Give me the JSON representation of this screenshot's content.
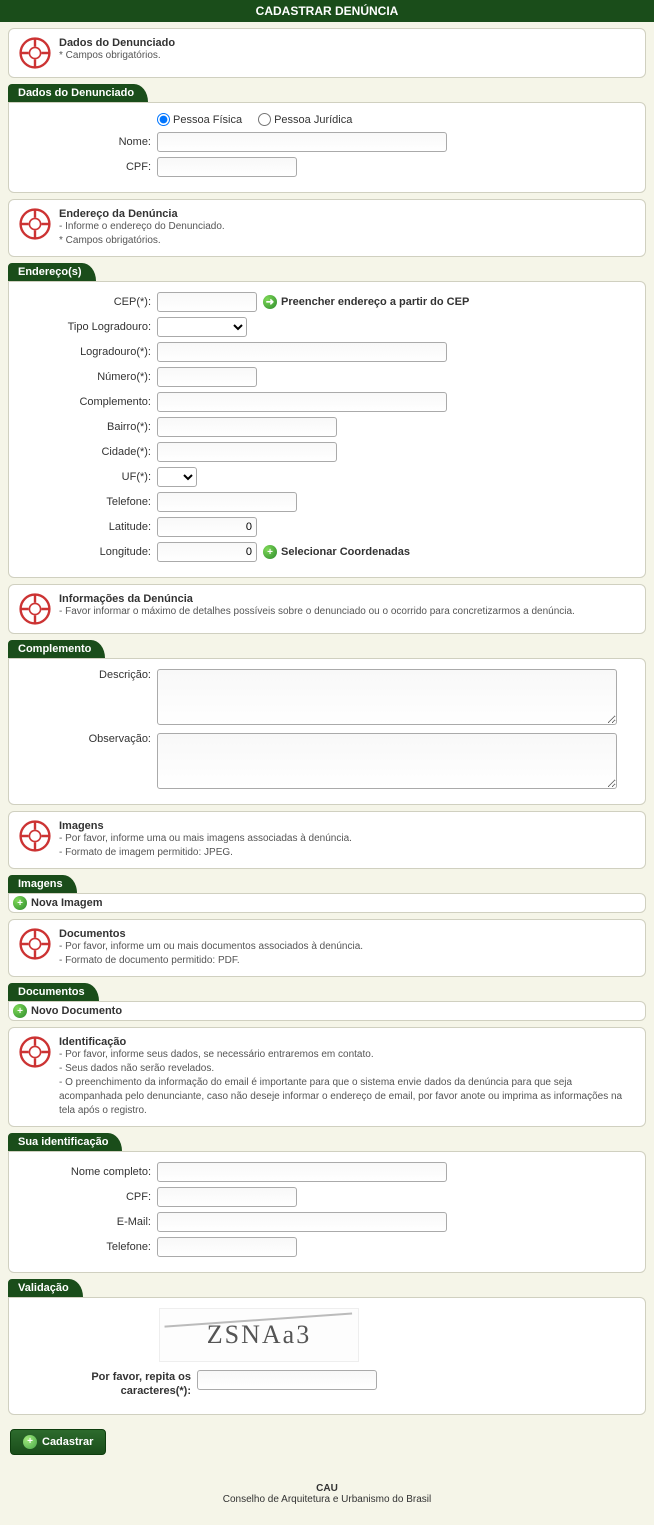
{
  "title": "CADASTRAR DENÚNCIA",
  "panels": {
    "dados_header": {
      "title": "Dados do Denunciado",
      "sub": "* Campos obrigatórios."
    },
    "endereco_header": {
      "title": "Endereço da Denúncia",
      "sub1": "- Informe o endereço do Denunciado.",
      "sub2": "* Campos obrigatórios."
    },
    "info_header": {
      "title": "Informações da Denúncia",
      "sub": "- Favor informar o máximo de detalhes possíveis sobre o denunciado ou o ocorrido para concretizarmos a denúncia."
    },
    "imagens_header": {
      "title": "Imagens",
      "sub1": "- Por favor, informe uma ou mais imagens associadas à denúncia.",
      "sub2": "- Formato de imagem permitido: JPEG."
    },
    "documentos_header": {
      "title": "Documentos",
      "sub1": "- Por favor, informe um ou mais documentos associados à denúncia.",
      "sub2": "- Formato de documento permitido: PDF."
    },
    "identificacao_header": {
      "title": "Identificação",
      "sub1": "- Por favor, informe seus dados, se necessário entraremos em contato.",
      "sub2": "- Seus dados não serão revelados.",
      "sub3": "- O preenchimento da informação do email é importante para que o sistema envie dados da denúncia para que seja acompanhada pelo denunciante, caso não deseje informar o endereço de email, por favor anote ou imprima as informações na tela após o registro."
    }
  },
  "sections": {
    "dados": {
      "tab": "Dados do Denunciado",
      "radio_pf": "Pessoa Física",
      "radio_pj": "Pessoa Jurídica",
      "nome": "Nome:",
      "cpf": "CPF:"
    },
    "endereco": {
      "tab": "Endereço(s)",
      "cep": "CEP(*):",
      "cep_link": "Preencher endereço a partir do CEP",
      "tipo_log": "Tipo Logradouro:",
      "logradouro": "Logradouro(*):",
      "numero": "Número(*):",
      "complemento": "Complemento:",
      "bairro": "Bairro(*):",
      "cidade": "Cidade(*):",
      "uf": "UF(*):",
      "telefone": "Telefone:",
      "latitude": "Latitude:",
      "latitude_val": "0",
      "longitude": "Longitude:",
      "longitude_val": "0",
      "coord_link": "Selecionar Coordenadas"
    },
    "complemento": {
      "tab": "Complemento",
      "descricao": "Descrição:",
      "observacao": "Observação:"
    },
    "imagens": {
      "tab": "Imagens",
      "nova": "Nova Imagem"
    },
    "documentos": {
      "tab": "Documentos",
      "novo": "Novo Documento"
    },
    "identificacao": {
      "tab": "Sua identificação",
      "nome": "Nome completo:",
      "cpf": "CPF:",
      "email": "E-Mail:",
      "telefone": "Telefone:"
    },
    "validacao": {
      "tab": "Validação",
      "captcha_text": "ZSNAa3",
      "repita": "Por favor, repita os caracteres(*):"
    }
  },
  "buttons": {
    "cadastrar": "Cadastrar"
  },
  "footer": {
    "title": "CAU",
    "sub": "Conselho de Arquitetura e Urbanismo do Brasil"
  }
}
